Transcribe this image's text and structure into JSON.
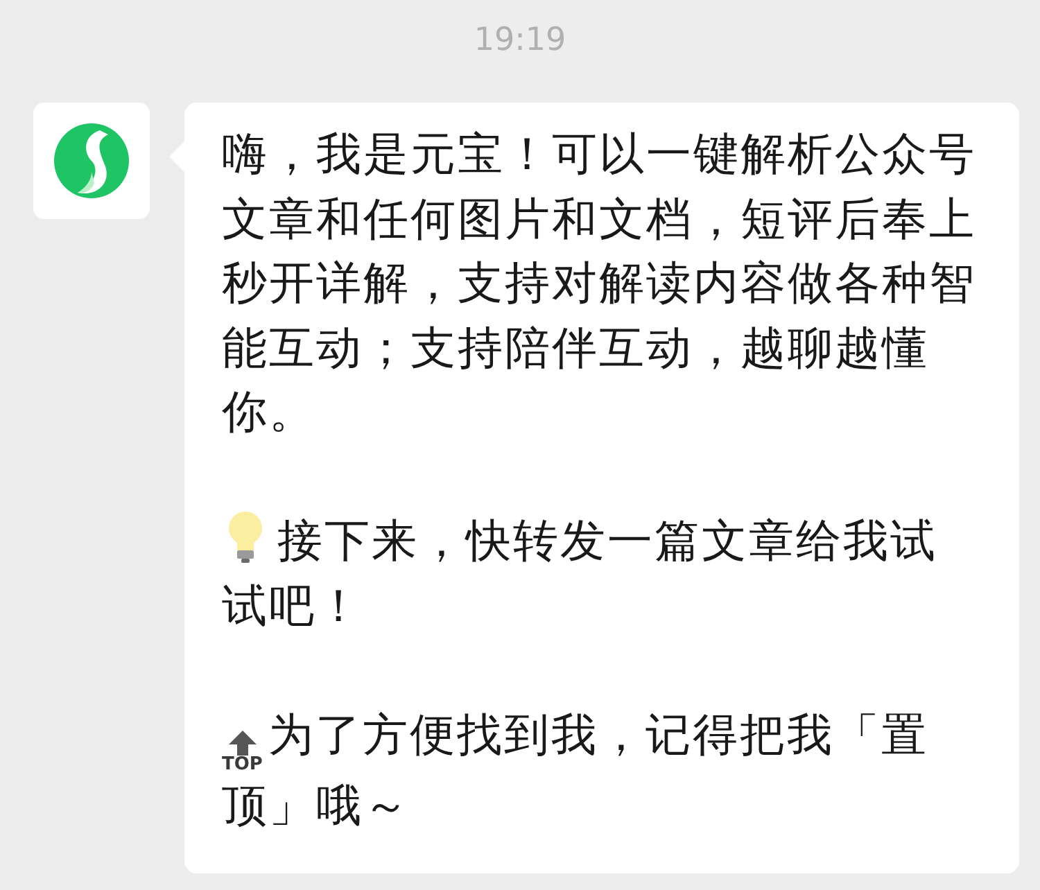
{
  "time": "19:19",
  "message": {
    "paragraphs": [
      {
        "kind": "plain",
        "text": "嗨，我是元宝！可以一键解析公众号文章和任何图片和文档，短评后奉上秒开详解，支持对解读内容做各种智能互动；支持陪伴互动，越聊越懂你。"
      },
      {
        "kind": "bulb",
        "text": "接下来，快转发一篇文章给我试试吧！"
      },
      {
        "kind": "top",
        "icon_label": "TOP",
        "text": "为了方便找到我，记得把我「置顶」哦～"
      }
    ]
  }
}
